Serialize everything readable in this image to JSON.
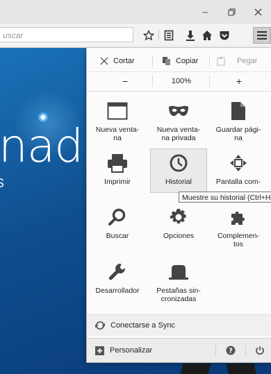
{
  "search": {
    "placeholder": "uscar"
  },
  "menu": {
    "edit": {
      "cut": "Cortar",
      "copy": "Copiar",
      "paste": "Pegar"
    },
    "zoom": {
      "minus": "−",
      "level": "100%",
      "plus": "+"
    },
    "tiles": {
      "new_window": "Nueva venta-\nna",
      "private_window": "Nueva venta-\nna privada",
      "save_page": "Guardar pági-\nna",
      "print": "Imprimir",
      "history": "Historial",
      "fullscreen": "Pantalla com-",
      "find": "Buscar",
      "options": "Opciones",
      "addons": "Complemen-\ntos",
      "developer": "Desarrollador",
      "synced_tabs": "Pestañas sin-\ncronizadas"
    },
    "tooltip": "Muestre su historial (Ctrl+H)",
    "sync": "Conectarse a Sync",
    "customize": "Personalizar"
  },
  "page": {
    "headline": "nado",
    "subtext": "s"
  }
}
